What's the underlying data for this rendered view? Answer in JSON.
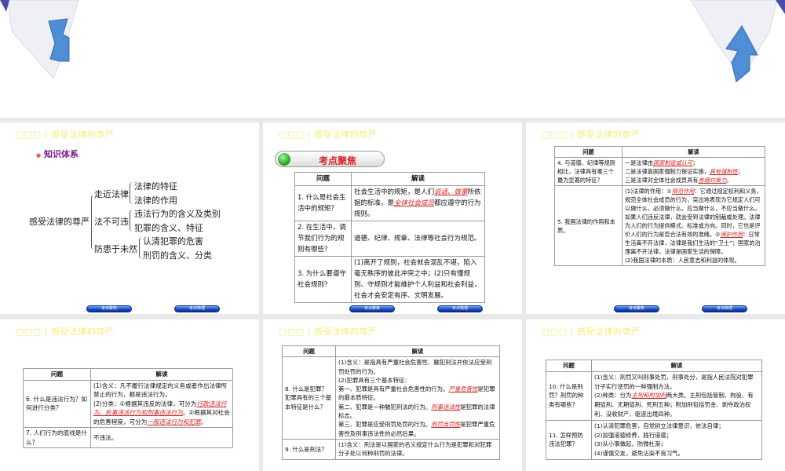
{
  "header": "□□□ | 感受法律的尊严",
  "nav": {
    "prev": "考点聚焦",
    "next": "考点梳理"
  },
  "slide1": {
    "section": "知识体系",
    "root": "感受法律的尊严",
    "branches": [
      {
        "label": "走近法律",
        "leaves": [
          "法律的特征",
          "法律的作用"
        ]
      },
      {
        "label": "法不可违",
        "leaves": [
          "违法行为的含义及类别",
          "犯罪的含义、特征"
        ]
      },
      {
        "label": "防患于未然",
        "leaves": [
          "认清犯罪的危害",
          "刑罚的含义、分类"
        ]
      }
    ]
  },
  "slide2": {
    "banner": "考点聚焦"
  },
  "col_q": "问题",
  "col_a": "解读",
  "tables": {
    "t2": [
      {
        "q": "1. 什么是社会生活中的规矩？",
        "a": [
          [
            {
              "t": "社会生活中的规矩，是人们"
            },
            {
              "t": "说话、做事",
              "hl": true
            },
            {
              "t": "所依据的标准，是"
            },
            {
              "t": "全体社会成员",
              "hl": true
            },
            {
              "t": "都应遵守的行为规则。"
            }
          ]
        ]
      },
      {
        "q": "2. 在生活中，调节我们行为的规则有哪些？",
        "a": [
          [
            {
              "t": "道德、纪律、规章、法律等社会行为规范。"
            }
          ]
        ]
      },
      {
        "q": "3. 为什么要遵守社会规则？",
        "a": [
          [
            {
              "t": "(1)离开了规则，社会就会混乱不堪，陷入毫无秩序的彼此冲突之中；(2)只有懂规则、守规则才能维护个人利益和社会利益，社会才会安定有序、文明发展。"
            }
          ]
        ]
      }
    ],
    "t3": [
      {
        "q": "4. 与道德、纪律等规则相比，法律具有哪三个最为显著的特征？",
        "a": [
          [
            {
              "t": "一是法律由"
            },
            {
              "t": "国家制定或认可",
              "hl": true
            },
            {
              "t": "；"
            }
          ],
          [
            {
              "t": "二是法律靠国家强制力保证实施，"
            },
            {
              "t": "具有强制性",
              "hl": true
            },
            {
              "t": "；"
            }
          ],
          [
            {
              "t": "三是法律对全体社会成员具有"
            },
            {
              "t": "普遍约束力",
              "hl": true
            },
            {
              "t": "。"
            }
          ]
        ]
      },
      {
        "q": "5. 我国法律的作用和本质。",
        "a": [
          [
            {
              "t": "(1)法律的作用：①"
            },
            {
              "t": "规范作用",
              "hl": true
            },
            {
              "t": "：它通过规定权利和义务，规范全体社会成员的行为，突出地表现为它规定人们可以做什么，必须做什么，应当做什么，不应当做什么。如果人们违反法律，就会受到法律的制裁或处理。法律为人们的行为提供模式、标准或方向。同时，它也是评价人们的行为是否合法有效的准绳。②"
            },
            {
              "t": "保护作用",
              "hl": true
            },
            {
              "t": "：日常生活离不开法律，法律是我们生活的“卫士”；国家的治理离不开法律，法律是国家生活的保障。"
            }
          ],
          [
            {
              "t": "(2)我国法律的本质：人民意志和利益的体现。"
            }
          ]
        ]
      }
    ],
    "t4": [
      {
        "q": "6. 什么是违法行为？如何进行分类？",
        "a": [
          [
            {
              "t": "(1)含义：凡不履行法律规定的义务或者作出法律所禁止的行为，都是违法行为。"
            }
          ],
          [
            {
              "t": "(2)分类：①根据其违反的法律，可分为"
            },
            {
              "t": "行政违法行为、民事违法行为和刑事违法行为",
              "hl": true
            },
            {
              "t": "。②根据其对社会的危害程度，可分为"
            },
            {
              "t": "一般违法行为和犯罪",
              "hl": true
            },
            {
              "t": "。"
            }
          ]
        ]
      },
      {
        "q": "7. 人们行为的底线是什么？",
        "a": [
          [
            {
              "t": "不违法。"
            }
          ]
        ]
      }
    ],
    "t5": [
      {
        "q": "8. 什么是犯罪？犯罪具有的三个基本特征是什么？",
        "a": [
          [
            {
              "t": "(1)含义：是指具有严重社会危害性、触犯刑法并依法应受刑罚处罚的行为。"
            }
          ],
          [
            {
              "t": "(2)犯罪具有三个基本特征："
            }
          ],
          [
            {
              "t": "第一、犯罪是具有严重社会危害性的行为。"
            },
            {
              "t": "严重危害性",
              "hl": true
            },
            {
              "t": "是犯罪的最本质特征。"
            }
          ],
          [
            {
              "t": "第二、犯罪是一种触犯刑法的行为。"
            },
            {
              "t": "刑事违法性",
              "hl": true
            },
            {
              "t": "是犯罪的法律标志。"
            }
          ],
          [
            {
              "t": "第三、犯罪是应受刑罚处罚的行为。"
            },
            {
              "t": "刑罚当罚性",
              "hl": true
            },
            {
              "t": "是犯罪严重危害性及刑事违法性的必然后果。"
            }
          ]
        ]
      },
      {
        "q": "9. 什么是刑法？",
        "a": [
          [
            {
              "t": "(1)含义：刑法是以国家的名义规定什么行为是犯罪和对犯罪分子处以何种刑罚的法律。"
            }
          ]
        ]
      }
    ],
    "t6": [
      {
        "q": "10. 什么是刑罚？刑罚的种类有哪些？",
        "a": [
          [
            {
              "t": "(1)含义：刑罚又叫刑事处罚，刑事处分，是指人民法院对犯罪分子实行惩罚的一种强制方法。"
            }
          ],
          [
            {
              "t": "(2)种类：分为"
            },
            {
              "t": "主刑和附加刑",
              "hl": true
            },
            {
              "t": "两大类。主刑包括管制、拘役、有期徒刑、无期徒刑、死刑五种；附加刑包括罚金、剥夺政治权利、没收财产、驱逐出境四种。"
            }
          ]
        ]
      },
      {
        "q": "11. 怎样预防违法犯罪？",
        "a": [
          [
            {
              "t": "(1)认清犯罪危害，自觉树立法律意识，依法自律；"
            }
          ],
          [
            {
              "t": "(2)加强道德修养，践行道德；"
            }
          ],
          [
            {
              "t": "(3)从小事做起，防微杜渐；"
            }
          ],
          [
            {
              "t": "(4)谨慎交友，避免沾染不良习气。"
            }
          ]
        ]
      }
    ]
  },
  "colors": {
    "header": "#f2ee7a",
    "highlight": "#e0201c",
    "section": "#7a1a8c",
    "gap": "#e9e9e9"
  }
}
